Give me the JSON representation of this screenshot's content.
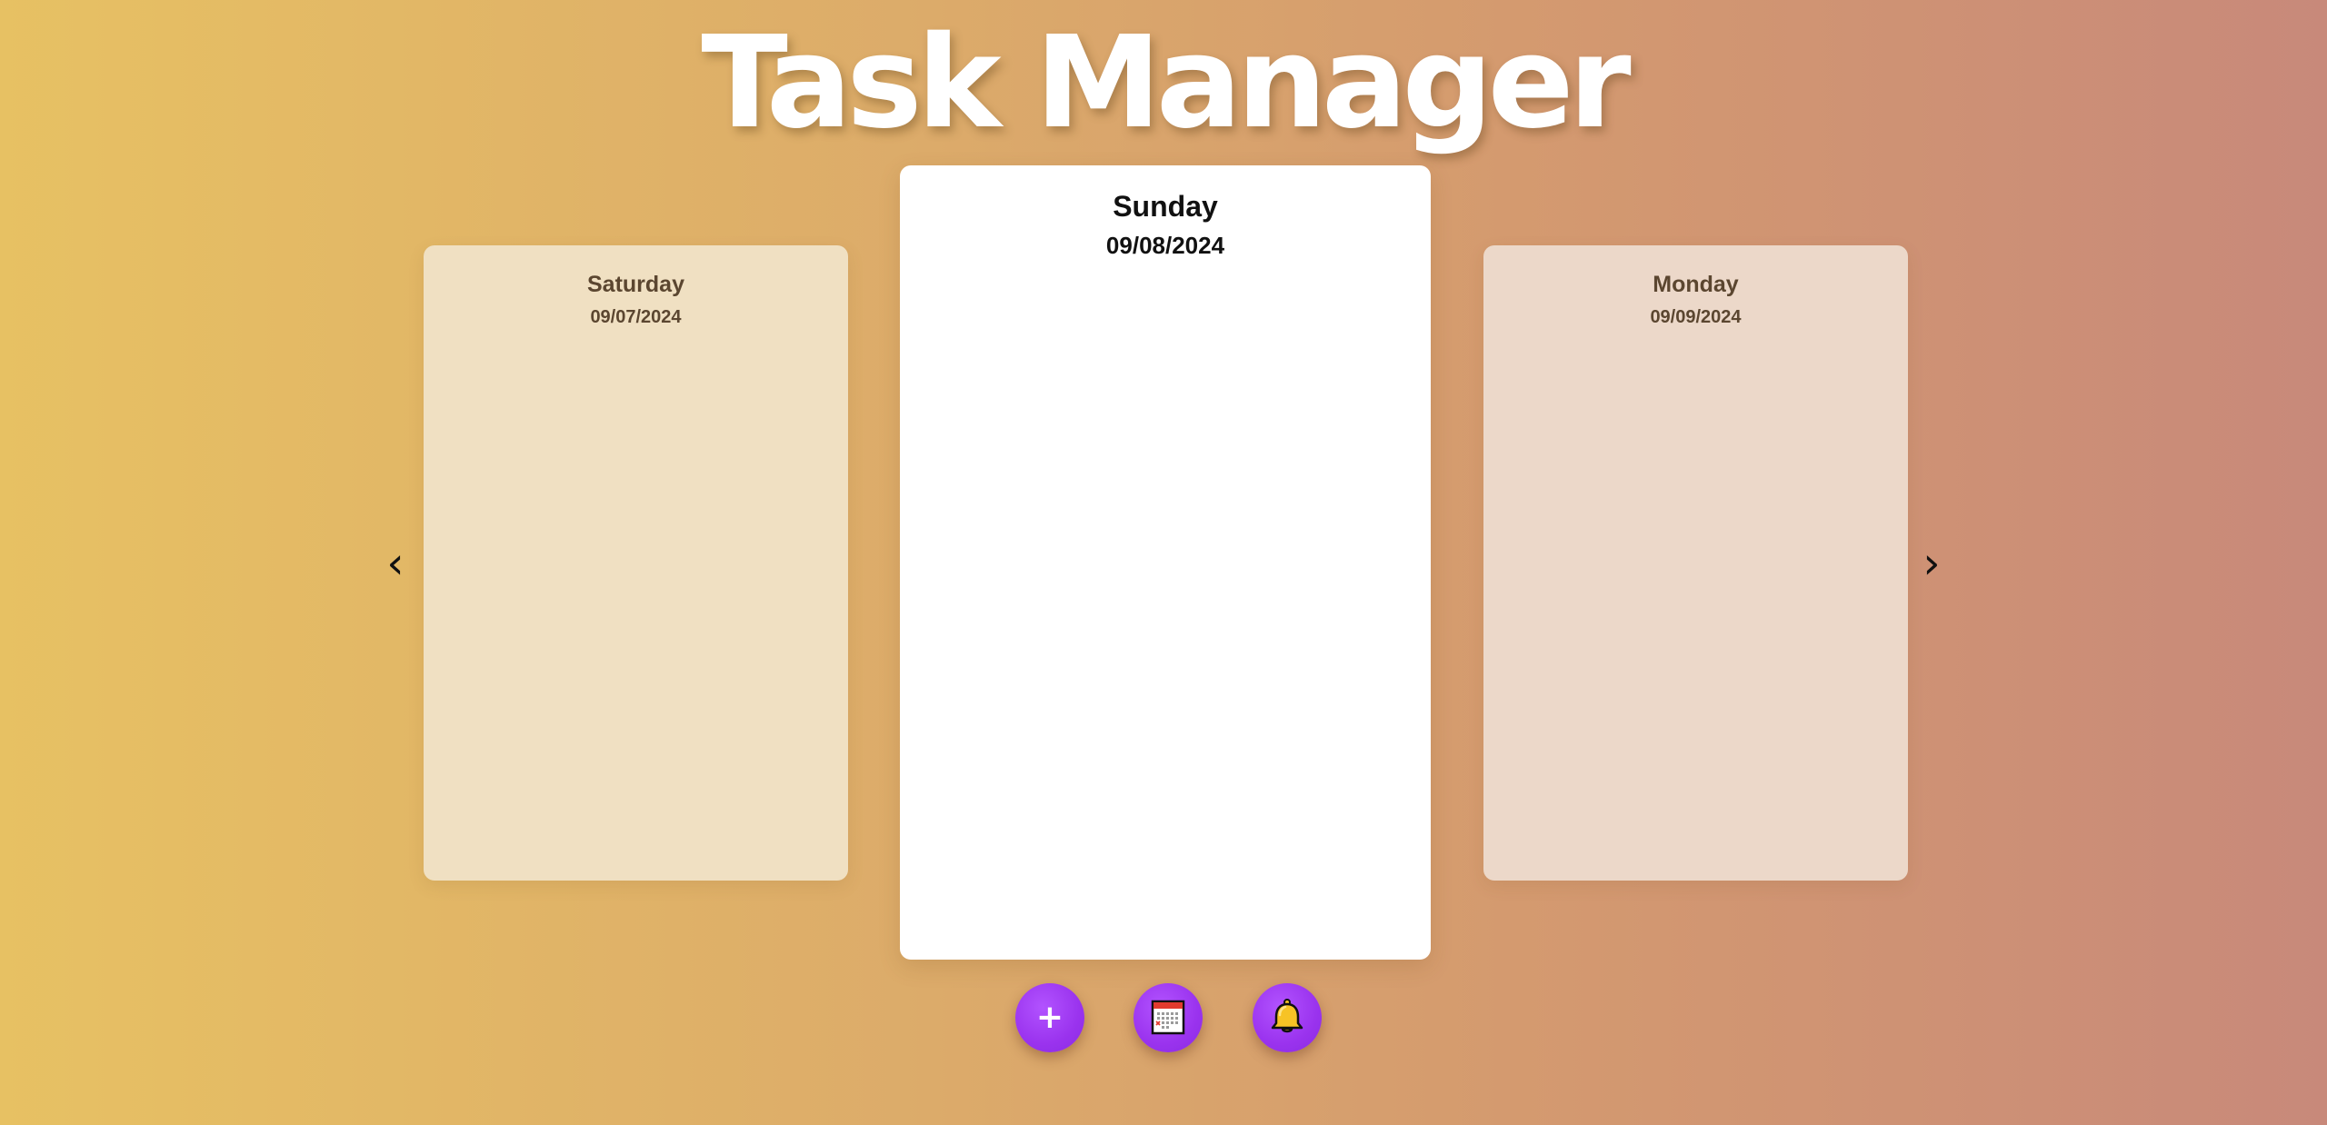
{
  "app": {
    "title": "Task Manager"
  },
  "navigation": {
    "prev_label": "‹",
    "next_label": "›"
  },
  "days": {
    "previous": {
      "day": "Saturday",
      "date": "09/07/2024"
    },
    "current": {
      "day": "Sunday",
      "date": "09/08/2024"
    },
    "next": {
      "day": "Monday",
      "date": "09/09/2024"
    }
  },
  "actions": {
    "add_label": "+",
    "add_icon": "plus-icon",
    "calendar_icon": "calendar-icon",
    "bell_icon": "bell-icon"
  },
  "colors": {
    "background_start": "#e7c163",
    "background_end": "#c8897a",
    "button": "#9a33ee",
    "bell": "#f7c325",
    "calendar_header": "#e23a2e"
  }
}
